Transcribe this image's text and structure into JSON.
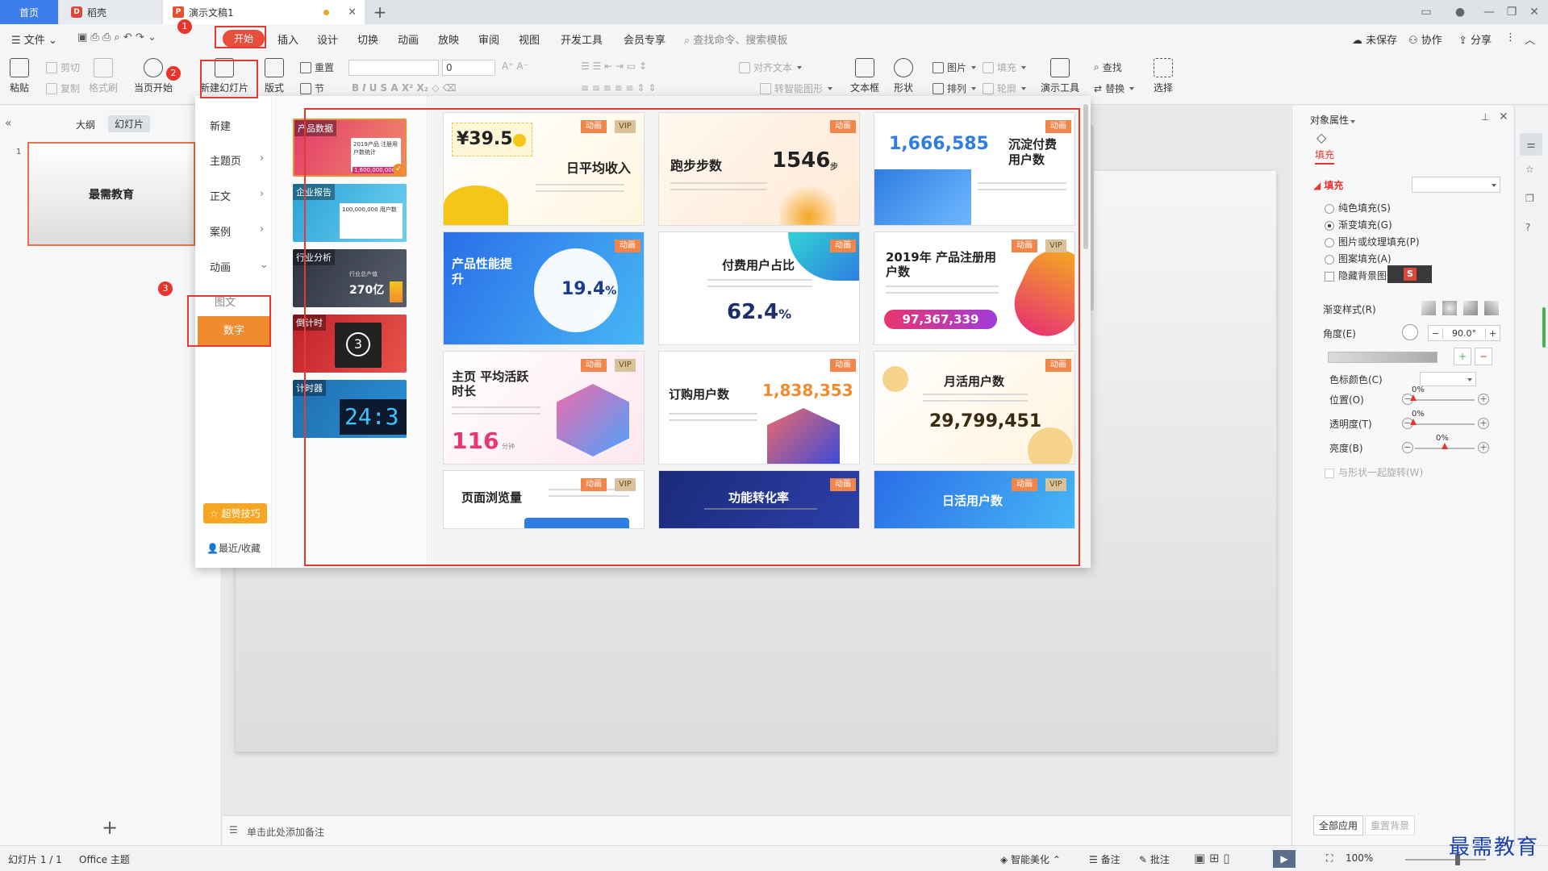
{
  "tabs": {
    "home": "首页",
    "docer": "稻壳",
    "doc": "演示文稿1"
  },
  "menu": {
    "file": "文件",
    "start": "开始",
    "insert": "插入",
    "design": "设计",
    "switch": "切换",
    "animation": "动画",
    "slideshow": "放映",
    "review": "审阅",
    "view": "视图",
    "devtools": "开发工具",
    "member": "会员专享",
    "search_placeholder": "查找命令、搜索模板",
    "unsaved": "未保存",
    "collab": "协作",
    "share": "分享"
  },
  "ribbon": {
    "paste": "粘贴",
    "cut": "剪切",
    "copy": "复制",
    "format_painter": "格式刷",
    "play_current": "当页开始",
    "new_slide": "新建幻灯片",
    "layout": "版式",
    "section": "节",
    "reset": "重置",
    "font_size": "0",
    "align_text": "对齐文本",
    "smart_art": "转智能图形",
    "textbox": "文本框",
    "shape": "形状",
    "arrange": "排列",
    "picture": "图片",
    "fill": "填充",
    "outline": "轮廓",
    "present_tool": "演示工具",
    "find": "查找",
    "replace": "替换",
    "select": "选择"
  },
  "leftpanel": {
    "outline_tab": "大纲",
    "slides_tab": "幻灯片",
    "slide_number": "1",
    "slide_title": "最需教育"
  },
  "badges": [
    "1",
    "2",
    "3"
  ],
  "dropdown": {
    "categories": [
      {
        "label": "新建",
        "arrow": ""
      },
      {
        "label": "主题页",
        "arrow": "›"
      },
      {
        "label": "正文",
        "arrow": "›"
      },
      {
        "label": "案例",
        "arrow": "›"
      },
      {
        "label": "动画",
        "arrow": "⌄"
      },
      {
        "label": "图文",
        "arrow": ""
      }
    ],
    "selected_category": "数字",
    "tips": "超赞技巧",
    "recent": "最近/收藏",
    "subcats": [
      {
        "label": "产品数据",
        "text": "2019产品 注册用户数统计",
        "value": "1,600,000,000"
      },
      {
        "label": "企业报告",
        "text": "100,000,000 用户数",
        "value": ""
      },
      {
        "label": "行业分析",
        "text": "行业总产值",
        "value": "270亿"
      },
      {
        "label": "倒计时",
        "text": "",
        "value": "3"
      },
      {
        "label": "计时器",
        "text": "",
        "value": "24:3"
      }
    ],
    "cards": [
      {
        "title": "日平均收入",
        "value": "¥39.5",
        "unit": "",
        "anim": "动画",
        "vip": "VIP"
      },
      {
        "title": "跑步步数",
        "value": "1546",
        "unit": "步",
        "anim": "动画",
        "vip": ""
      },
      {
        "title": "沉淀付费用户数",
        "value": "1,666,585",
        "unit": "",
        "anim": "动画",
        "vip": ""
      },
      {
        "title": "产品性能提升",
        "value": "19.4",
        "unit": "%",
        "anim": "动画",
        "vip": ""
      },
      {
        "title": "付费用户占比",
        "value": "62.4",
        "unit": "%",
        "anim": "动画",
        "vip": ""
      },
      {
        "title": "2019年 产品注册用户数",
        "value": "97,367,339",
        "unit": "",
        "anim": "动画",
        "vip": "VIP"
      },
      {
        "title": "主页 平均活跃时长",
        "value": "116",
        "unit": "分钟",
        "anim": "动画",
        "vip": "VIP"
      },
      {
        "title": "订购用户数",
        "value": "1,838,353",
        "unit": "",
        "anim": "动画",
        "vip": ""
      },
      {
        "title": "月活用户数",
        "value": "29,799,451",
        "unit": "",
        "anim": "动画",
        "vip": ""
      },
      {
        "title": "页面浏览量",
        "value": "",
        "unit": "",
        "anim": "动画",
        "vip": "VIP"
      },
      {
        "title": "功能转化率",
        "value": "",
        "unit": "",
        "anim": "动画",
        "vip": ""
      },
      {
        "title": "日活用户数",
        "value": "",
        "unit": "",
        "anim": "动画",
        "vip": "VIP"
      }
    ]
  },
  "canvas": {
    "notes_placeholder": "单击此处添加备注"
  },
  "rightpanel": {
    "title": "对象属性",
    "fill_tab": "填充",
    "fill_section": "填充",
    "opt_solid": "纯色填充(S)",
    "opt_gradient": "渐变填充(G)",
    "opt_picture": "图片或纹理填充(P)",
    "opt_pattern": "图案填充(A)",
    "hide_bg": "隐藏背景图形",
    "grad_style": "渐变样式(R)",
    "angle_label": "角度(E)",
    "angle_value": "90.0°",
    "color_stop": "色标颜色(C)",
    "position_label": "位置(O)",
    "position_value": "0%",
    "transparency_label": "透明度(T)",
    "transparency_value": "0%",
    "brightness_label": "亮度(B)",
    "brightness_value": "0%",
    "rotate_with_shape": "与形状一起旋转(W)",
    "apply_all": "全部应用",
    "reset_bg": "重置背景"
  },
  "status": {
    "slide_count": "幻灯片 1 / 1",
    "theme": "Office 主题",
    "beautify": "智能美化",
    "notes": "备注",
    "comments": "批注",
    "zoom": "100%"
  },
  "watermark": "最需教育",
  "colors": {
    "accent_red": "#e9352b",
    "tab_blue": "#3d7eea",
    "orange": "#f08c2e"
  }
}
